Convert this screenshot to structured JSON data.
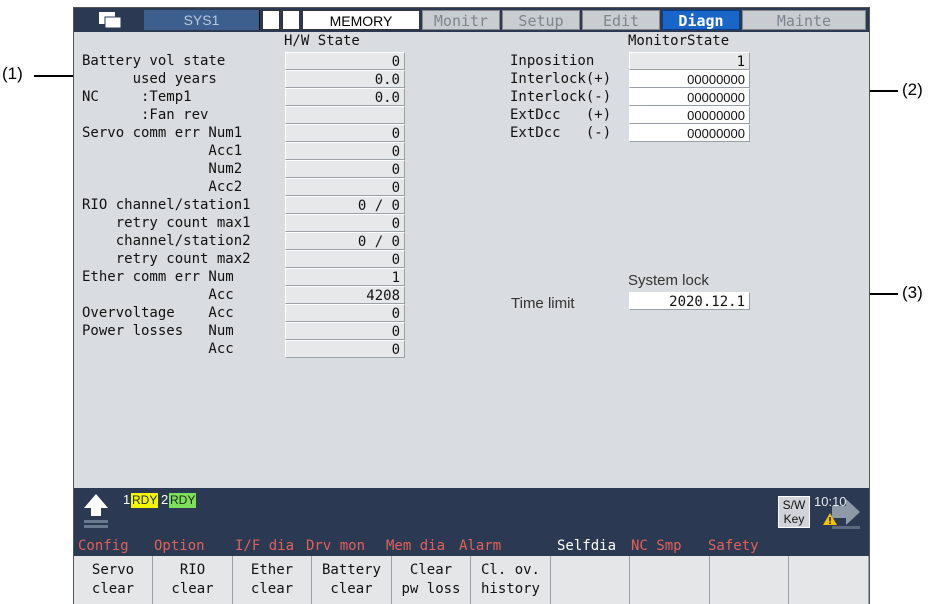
{
  "callouts": {
    "c1": "(1)",
    "c2": "(2)",
    "c3": "(3)"
  },
  "topbar": {
    "system": "SYS1",
    "mode": "MEMORY",
    "menus": [
      "Monitr",
      "Setup",
      "Edit",
      "Diagn",
      "Mainte"
    ],
    "active_menu": "Diagn"
  },
  "hw": {
    "title": "H/W State",
    "rows": [
      {
        "label": "Battery vol state",
        "value": "0"
      },
      {
        "label": "      used years",
        "value": "0.0"
      },
      {
        "label": "NC     :Temp1",
        "value": "0.0"
      },
      {
        "label": "       :Fan rev",
        "value": ""
      },
      {
        "label": "Servo comm err Num1",
        "value": "0"
      },
      {
        "label": "               Acc1",
        "value": "0"
      },
      {
        "label": "               Num2",
        "value": "0"
      },
      {
        "label": "               Acc2",
        "value": "0"
      },
      {
        "label": "RIO channel/station1",
        "value": "0 / 0"
      },
      {
        "label": "    retry count max1",
        "value": "0"
      },
      {
        "label": "    channel/station2",
        "value": "0 / 0"
      },
      {
        "label": "    retry count max2",
        "value": "0"
      },
      {
        "label": "Ether comm err Num",
        "value": "1"
      },
      {
        "label": "               Acc",
        "value": "4208"
      },
      {
        "label": "Overvoltage    Acc",
        "value": "0"
      },
      {
        "label": "Power losses   Num",
        "value": "0"
      },
      {
        "label": "               Acc",
        "value": "0"
      }
    ]
  },
  "monitor": {
    "title": "MonitorState",
    "rows": [
      {
        "label": "Inposition",
        "value": "1"
      },
      {
        "label": "Interlock(+)",
        "value": "00000000"
      },
      {
        "label": "Interlock(-)",
        "value": "00000000"
      },
      {
        "label": "ExtDcc   (+)",
        "value": "00000000"
      },
      {
        "label": "ExtDcc   (-)",
        "value": "00000000"
      }
    ]
  },
  "system_lock": {
    "title": "System lock",
    "label": "Time limit",
    "value": "2020.12.1"
  },
  "status": {
    "rdy1_num": "1",
    "rdy1": "RDY",
    "rdy2_num": "2",
    "rdy2": "RDY",
    "swkey_line1": "S/W",
    "swkey_line2": "Key",
    "time": "10:10"
  },
  "menu_titles": [
    {
      "label": "Config",
      "color": "#e0605a"
    },
    {
      "label": "Option",
      "color": "#e0605a"
    },
    {
      "label": "I/F dia",
      "color": "#e0605a"
    },
    {
      "label": "Drv mon",
      "color": "#e0605a"
    },
    {
      "label": "Mem dia",
      "color": "#e0605a"
    },
    {
      "label": "Alarm",
      "color": "#e0605a"
    },
    {
      "label": "Selfdia",
      "color": "#ffffff"
    },
    {
      "label": "NC Smp",
      "color": "#e0605a"
    },
    {
      "label": "Safety",
      "color": "#e0605a"
    }
  ],
  "fkeys": [
    {
      "line1": "Servo",
      "line2": "clear"
    },
    {
      "line1": "RIO",
      "line2": "clear"
    },
    {
      "line1": "Ether",
      "line2": "clear"
    },
    {
      "line1": "Battery",
      "line2": "clear"
    },
    {
      "line1": "Clear",
      "line2": "pw loss"
    },
    {
      "line1": "Cl. ov.",
      "line2": "history"
    },
    {
      "line1": "",
      "line2": ""
    },
    {
      "line1": "",
      "line2": ""
    },
    {
      "line1": "",
      "line2": ""
    },
    {
      "line1": "",
      "line2": ""
    }
  ],
  "colors": {
    "frame_dark": "#2b3a52",
    "active_tab": "#1a66c8",
    "menu_title_red": "#e0605a",
    "rdy_yellow": "#f6f600",
    "rdy_green": "#7ee05a"
  }
}
